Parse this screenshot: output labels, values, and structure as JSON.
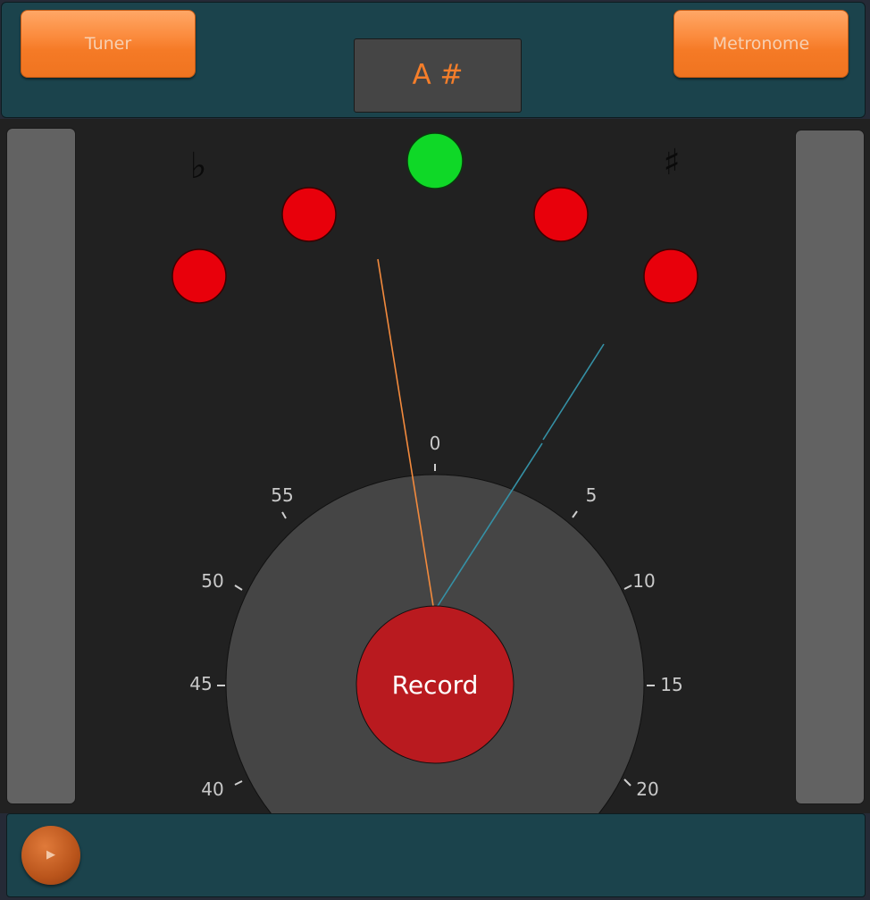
{
  "header": {
    "tuner_label": "Tuner",
    "metronome_label": "Metronome",
    "note": "A #"
  },
  "tuner": {
    "flat_symbol": "♭",
    "sharp_symbol": "♯",
    "indicator_colors": {
      "off": "#e8000b",
      "in_tune": "#0fd827"
    },
    "record_label": "Record",
    "dial_labels": [
      "0",
      "5",
      "10",
      "15",
      "20",
      "40",
      "45",
      "50",
      "55"
    ],
    "needle_colors": {
      "pitch": "#f38a3d",
      "beat": "#3591a6"
    }
  },
  "footer": {
    "play_icon": "play-icon"
  }
}
